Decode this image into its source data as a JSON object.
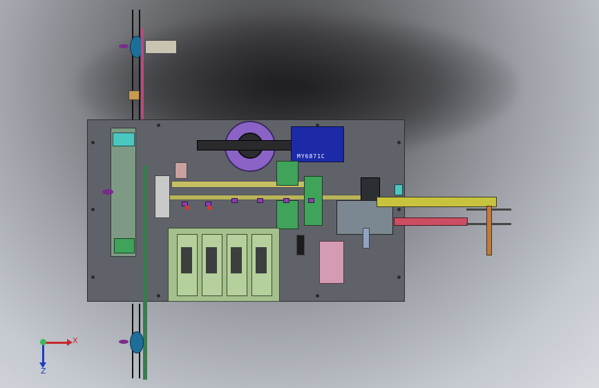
{
  "scene": {
    "motor_label": "MY6871C",
    "triad": {
      "x_label": "X",
      "z_label": "Z"
    }
  },
  "colors": {
    "base_plate": "#5f6268",
    "motor_blue": "#1d2aa8",
    "ring_purple": "#8b63c7",
    "arm_yellow": "#c8c33e",
    "arm_red": "#cc4e62",
    "module_green": "#a5c08c"
  },
  "icons": [
    "view-triad-icon"
  ]
}
